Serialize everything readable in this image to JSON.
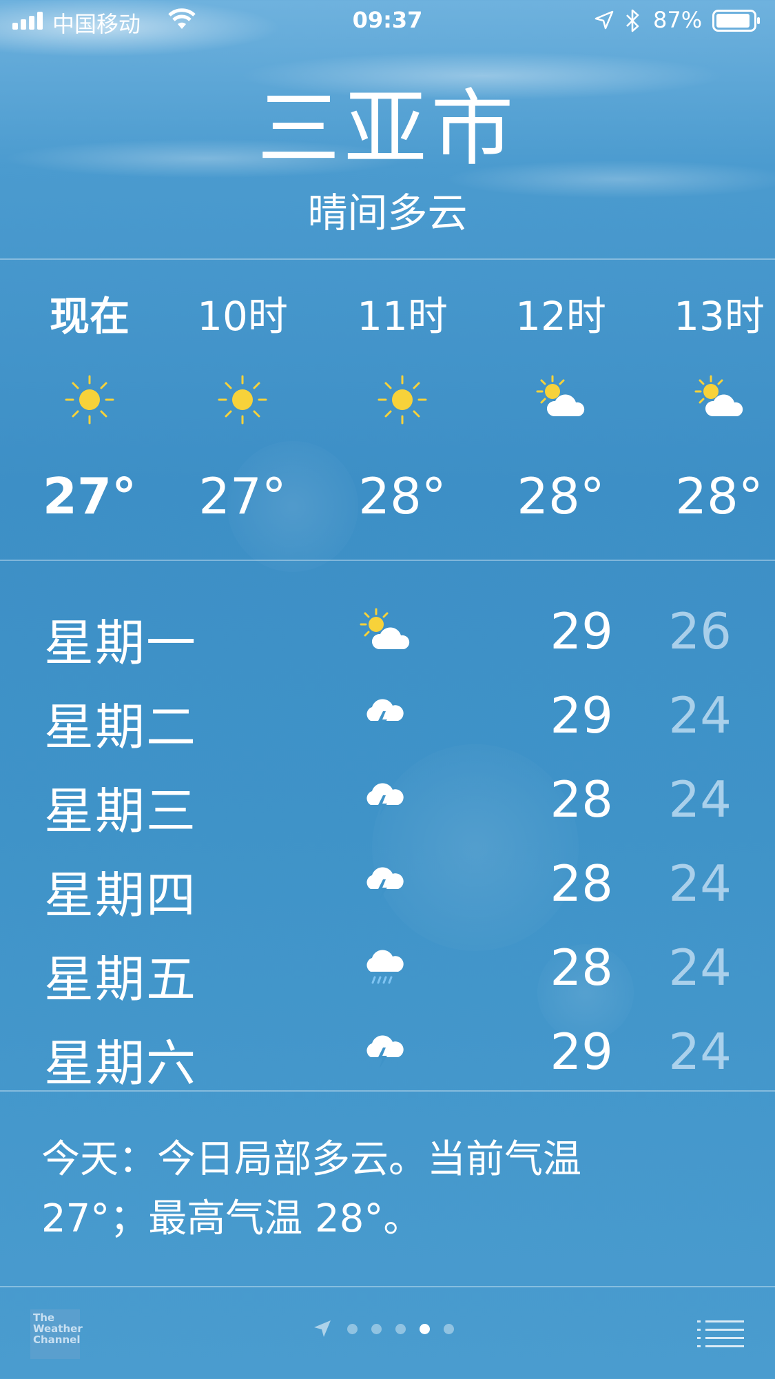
{
  "status_bar": {
    "carrier": "中国移动",
    "time": "09:37",
    "battery": "87%",
    "icons": [
      "signal-icon",
      "wifi-icon",
      "location-icon",
      "bluetooth-icon",
      "battery-icon"
    ]
  },
  "header": {
    "city": "三亚市",
    "condition": "晴间多云"
  },
  "hourly": [
    {
      "label": "现在",
      "icon": "sun-icon",
      "temp": "27°"
    },
    {
      "label": "10时",
      "icon": "sun-icon",
      "temp": "27°"
    },
    {
      "label": "11时",
      "icon": "sun-icon",
      "temp": "28°"
    },
    {
      "label": "12时",
      "icon": "partly-cloudy-icon",
      "temp": "28°"
    },
    {
      "label": "13时",
      "icon": "partly-cloudy-icon",
      "temp": "28°"
    }
  ],
  "daily": [
    {
      "day": "星期一",
      "icon": "partly-cloudy-icon",
      "high": "29",
      "low": "26"
    },
    {
      "day": "星期二",
      "icon": "thunderstorm-icon",
      "high": "29",
      "low": "24"
    },
    {
      "day": "星期三",
      "icon": "thunderstorm-icon",
      "high": "28",
      "low": "24"
    },
    {
      "day": "星期四",
      "icon": "thunderstorm-icon",
      "high": "28",
      "low": "24"
    },
    {
      "day": "星期五",
      "icon": "rain-icon",
      "high": "28",
      "low": "24"
    },
    {
      "day": "星期六",
      "icon": "thunderstorm-icon",
      "high": "29",
      "low": "24"
    }
  ],
  "summary": {
    "line1": "今天：今日局部多云。当前气温",
    "line2": "27°；最高气温 28°。"
  },
  "bottom_bar": {
    "logo_text": [
      "The",
      "Weather",
      "Channel"
    ],
    "page_count": 5,
    "active_page": 4
  },
  "colors": {
    "sky": "#3f93c8",
    "sun": "#f7d23a",
    "low_temp": "#a9cfe9"
  }
}
